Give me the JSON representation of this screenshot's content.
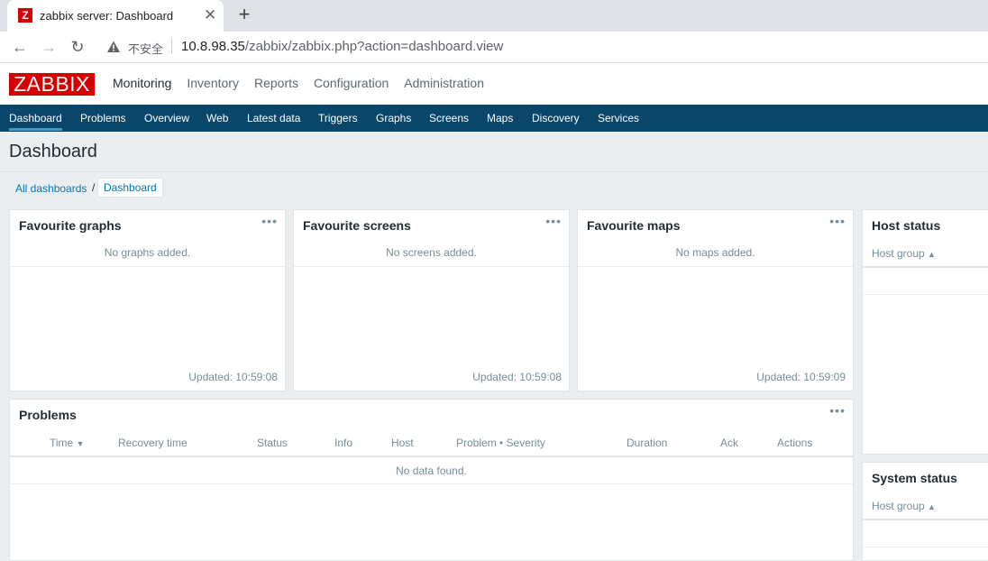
{
  "browser": {
    "tab_favicon": "Z",
    "tab_title": "zabbix server: Dashboard",
    "close_glyph": "✕",
    "newtab_glyph": "+",
    "back_glyph": "←",
    "forward_glyph": "→",
    "reload_glyph": "↻",
    "insecure_label": "不安全",
    "url_host": "10.8.98.35",
    "url_path": "/zabbix/zabbix.php?action=dashboard.view"
  },
  "header": {
    "logo": "ZABBIX",
    "main_menu": [
      "Monitoring",
      "Inventory",
      "Reports",
      "Configuration",
      "Administration"
    ],
    "sub_menu": [
      "Dashboard",
      "Problems",
      "Overview",
      "Web",
      "Latest data",
      "Triggers",
      "Graphs",
      "Screens",
      "Maps",
      "Discovery",
      "Services"
    ]
  },
  "page": {
    "title": "Dashboard",
    "breadcrumb_all": "All dashboards",
    "breadcrumb_sep": "/",
    "breadcrumb_current": "Dashboard"
  },
  "widgets": {
    "menu_glyph": "•••",
    "fav_graphs": {
      "title": "Favourite graphs",
      "empty": "No graphs added.",
      "updated": "Updated: 10:59:08"
    },
    "fav_screens": {
      "title": "Favourite screens",
      "empty": "No screens added.",
      "updated": "Updated: 10:59:08"
    },
    "fav_maps": {
      "title": "Favourite maps",
      "empty": "No maps added.",
      "updated": "Updated: 10:59:09"
    },
    "host_status": {
      "title": "Host status",
      "col": "Host group",
      "sort_glyph": "▲"
    },
    "system_status": {
      "title": "System status",
      "col": "Host group",
      "sort_glyph": "▲"
    },
    "problems": {
      "title": "Problems",
      "columns": [
        "Time",
        "Recovery time",
        "Status",
        "Info",
        "Host",
        "Problem • Severity",
        "Duration",
        "Ack",
        "Actions"
      ],
      "time_sort_glyph": "▼",
      "empty": "No data found."
    }
  },
  "colors": {
    "brand_red": "#d40000",
    "nav_blue": "#0a466a",
    "link_blue": "#0275b8",
    "active_underline": "#4796c4"
  }
}
